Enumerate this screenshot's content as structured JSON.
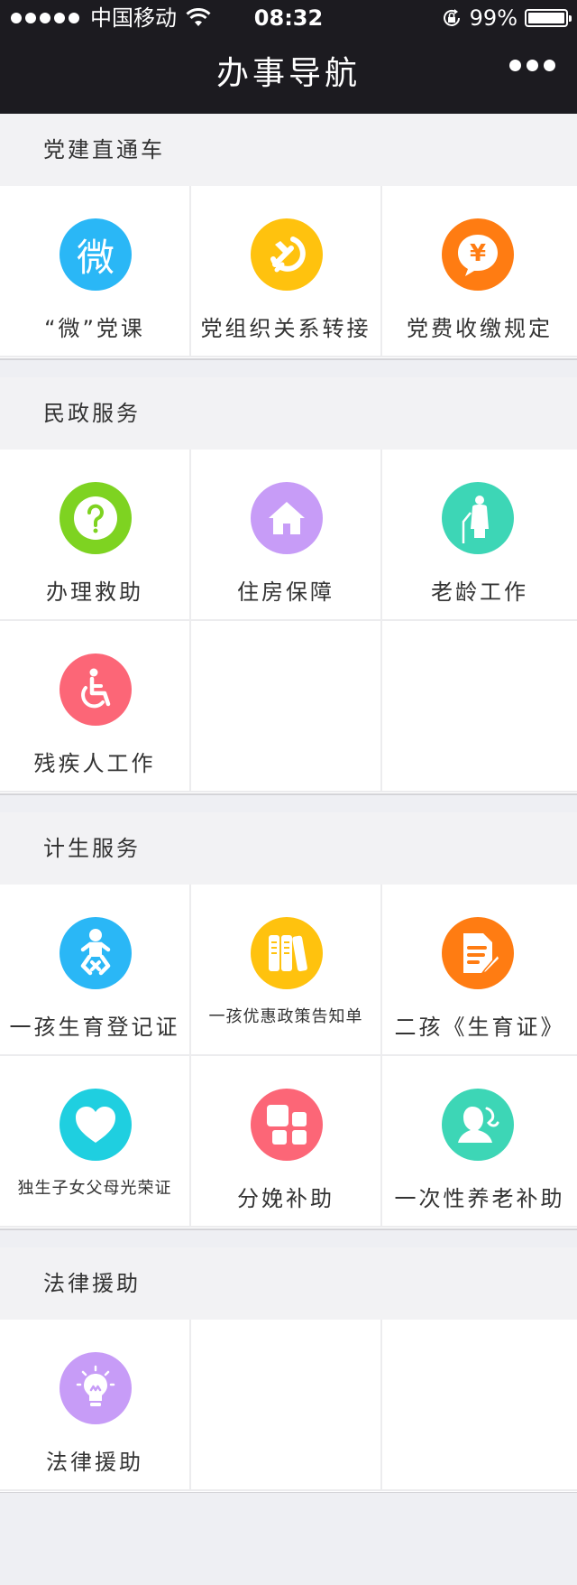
{
  "status_bar": {
    "carrier": "中国移动",
    "time": "08:32",
    "battery": "99%",
    "battery_level": 0.99
  },
  "nav": {
    "title": "办事导航"
  },
  "sections": [
    {
      "title": "党建直通车",
      "items": [
        {
          "label": "“微”党课",
          "icon": "wei-icon",
          "color": "#2ab7f6",
          "glyph": "微"
        },
        {
          "label": "党组织关系转接",
          "icon": "hammer-sickle-icon",
          "color": "#ffc20e"
        },
        {
          "label": "党费收缴规定",
          "icon": "yuan-icon",
          "color": "#ff7c12"
        }
      ]
    },
    {
      "title": "民政服务",
      "items": [
        {
          "label": "办理救助",
          "icon": "question-icon",
          "color": "#7ed321"
        },
        {
          "label": "住房保障",
          "icon": "house-icon",
          "color": "#c79cf7"
        },
        {
          "label": "老龄工作",
          "icon": "elderly-icon",
          "color": "#3dd6b6"
        },
        {
          "label": "残疾人工作",
          "icon": "wheelchair-icon",
          "color": "#fc6677"
        }
      ]
    },
    {
      "title": "计生服务",
      "items": [
        {
          "label": "一孩生育登记证",
          "icon": "baby-icon",
          "color": "#2ab7f6"
        },
        {
          "label": "一孩优惠政策告知单",
          "icon": "books-icon",
          "color": "#ffc20e"
        },
        {
          "label": "二孩《生育证》",
          "icon": "document-edit-icon",
          "color": "#ff7c12"
        },
        {
          "label": "独生子女父母光荣证",
          "icon": "heart-icon",
          "color": "#1fcfe0"
        },
        {
          "label": "分娩补助",
          "icon": "blocks-icon",
          "color": "#fc6677"
        },
        {
          "label": "一次性养老补助",
          "icon": "person-icon",
          "color": "#3dd6b6"
        }
      ]
    },
    {
      "title": "法律援助",
      "items": [
        {
          "label": "法律援助",
          "icon": "lightbulb-icon",
          "color": "#c79cf7"
        }
      ]
    }
  ]
}
